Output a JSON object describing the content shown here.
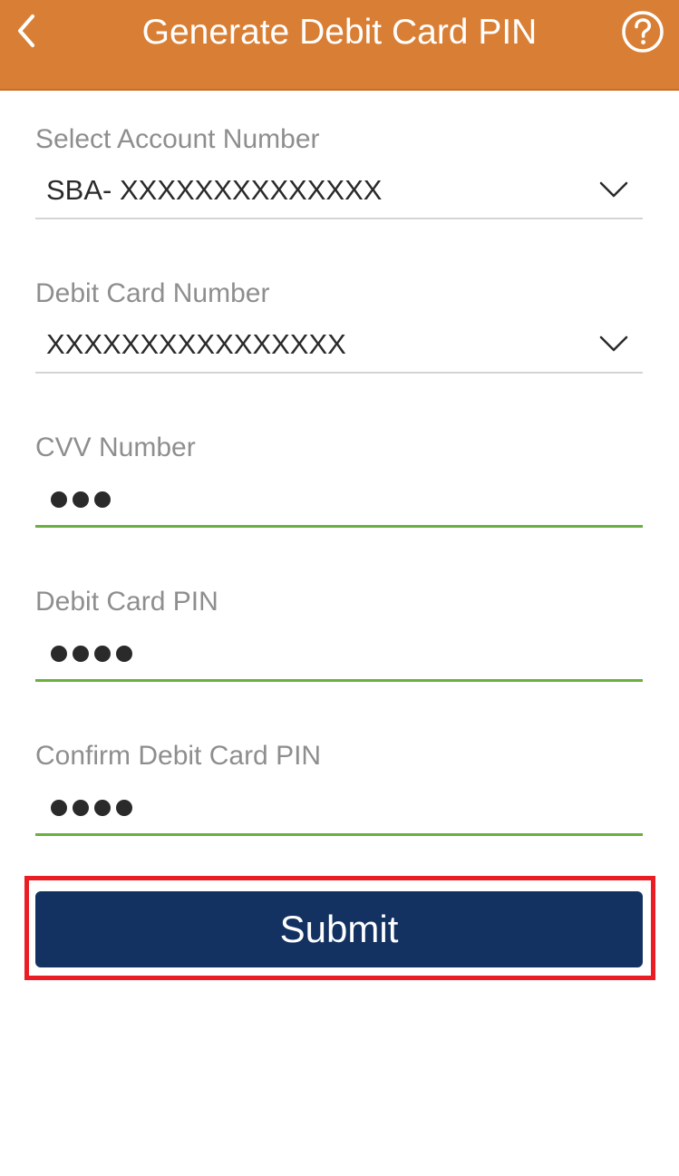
{
  "header": {
    "title": "Generate Debit Card PIN",
    "background_color": "#d97f35",
    "back_icon": "chevron-left-icon",
    "help_icon": "question-circle-icon"
  },
  "form": {
    "account": {
      "label": "Select Account Number",
      "value": "SBA- XXXXXXXXXXXXXX",
      "icon": "chevron-down-icon"
    },
    "debit_card": {
      "label": "Debit Card Number",
      "value": "XXXXXXXXXXXXXXXX",
      "icon": "chevron-down-icon"
    },
    "cvv": {
      "label": "CVV Number",
      "masked_length": 3
    },
    "pin": {
      "label": "Debit Card PIN",
      "masked_length": 4
    },
    "confirm_pin": {
      "label": "Confirm Debit Card PIN",
      "masked_length": 4
    },
    "active_field_color": "#6aaf3f"
  },
  "submit": {
    "label": "Submit",
    "background_color": "#133262",
    "highlight_color": "#ea1c24"
  }
}
